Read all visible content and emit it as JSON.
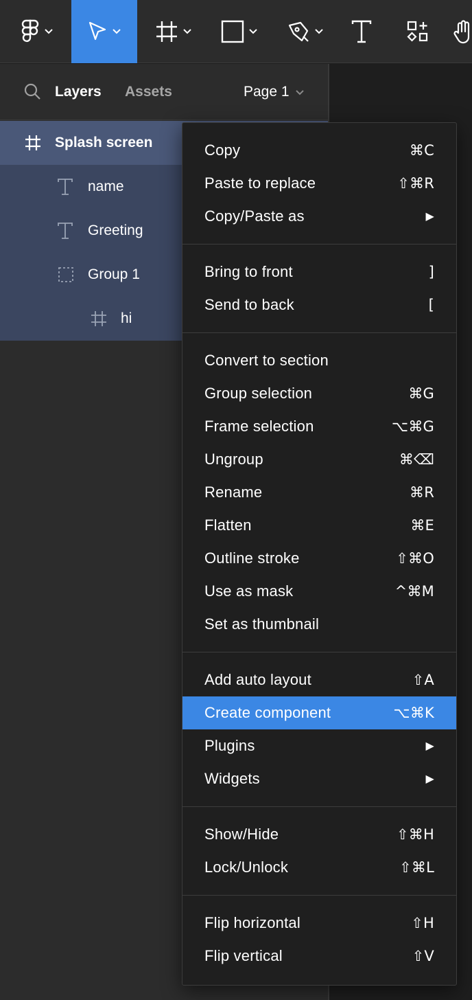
{
  "toolbar": {
    "tools": [
      {
        "name": "main-menu",
        "icon": "figma-logo-icon",
        "has_dropdown": true
      },
      {
        "name": "move",
        "icon": "move-cursor-icon",
        "has_dropdown": true,
        "active": true
      },
      {
        "name": "frame",
        "icon": "frame-icon",
        "has_dropdown": true
      },
      {
        "name": "shape",
        "icon": "rectangle-icon",
        "has_dropdown": true
      },
      {
        "name": "pen",
        "icon": "pen-icon",
        "has_dropdown": true
      },
      {
        "name": "text",
        "icon": "text-icon"
      },
      {
        "name": "resources",
        "icon": "resources-icon"
      },
      {
        "name": "hand",
        "icon": "hand-icon"
      }
    ],
    "active_color": "#3b87e4"
  },
  "panel": {
    "tabs": {
      "layers": "Layers",
      "assets": "Assets"
    },
    "page": "Page 1"
  },
  "layers": [
    {
      "label": "Splash screen",
      "icon": "frame-icon",
      "depth": 0
    },
    {
      "label": "name",
      "icon": "text-icon",
      "depth": 1
    },
    {
      "label": "Greeting",
      "icon": "text-icon",
      "depth": 1
    },
    {
      "label": "Group 1",
      "icon": "group-icon",
      "depth": 1
    },
    {
      "label": "hi",
      "icon": "frame-icon",
      "depth": 2
    }
  ],
  "menu": {
    "groups": [
      [
        {
          "label": "Copy",
          "shortcut": "⌘C"
        },
        {
          "label": "Paste to replace",
          "shortcut": "⇧⌘R"
        },
        {
          "label": "Copy/Paste as",
          "submenu": "▶"
        }
      ],
      [
        {
          "label": "Bring to front",
          "shortcut": "]"
        },
        {
          "label": "Send to back",
          "shortcut": "["
        }
      ],
      [
        {
          "label": "Convert to section",
          "shortcut": ""
        },
        {
          "label": "Group selection",
          "shortcut": "⌘G"
        },
        {
          "label": "Frame selection",
          "shortcut": "⌥⌘G"
        },
        {
          "label": "Ungroup",
          "shortcut": "⌘⌫"
        },
        {
          "label": "Rename",
          "shortcut": "⌘R"
        },
        {
          "label": "Flatten",
          "shortcut": "⌘E"
        },
        {
          "label": "Outline stroke",
          "shortcut": "⇧⌘O"
        },
        {
          "label": "Use as mask",
          "shortcut": "^⌘M"
        },
        {
          "label": "Set as thumbnail",
          "shortcut": ""
        }
      ],
      [
        {
          "label": "Add auto layout",
          "shortcut": "⇧A"
        },
        {
          "label": "Create component",
          "shortcut": "⌥⌘K",
          "highlighted": true
        },
        {
          "label": "Plugins",
          "submenu": "▶"
        },
        {
          "label": "Widgets",
          "submenu": "▶"
        }
      ],
      [
        {
          "label": "Show/Hide",
          "shortcut": "⇧⌘H"
        },
        {
          "label": "Lock/Unlock",
          "shortcut": "⇧⌘L"
        }
      ],
      [
        {
          "label": "Flip horizontal",
          "shortcut": "⇧H"
        },
        {
          "label": "Flip vertical",
          "shortcut": "⇧V"
        }
      ]
    ],
    "highlight_color": "#3b87e4"
  }
}
